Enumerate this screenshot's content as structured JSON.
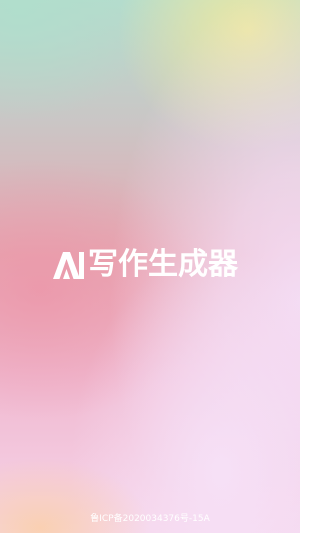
{
  "splash": {
    "app_title": "写作生成器",
    "logo_icon": "ai-logo-icon",
    "icp_notice": "鲁ICP备2020034376号-15A"
  },
  "colors": {
    "text": "#ffffff",
    "mint": "#b5dccd",
    "pink": "#e7a8b2",
    "yellow": "#eee8a0",
    "lilac": "#f4def6",
    "peach": "#fad0ac"
  }
}
